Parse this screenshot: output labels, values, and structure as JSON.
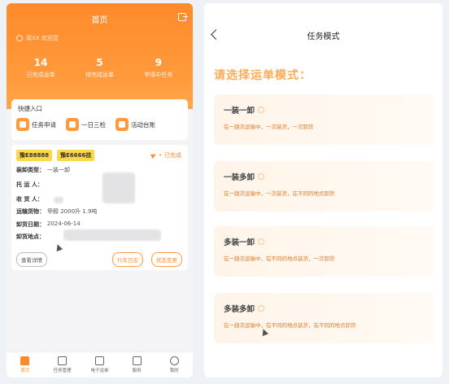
{
  "left": {
    "header": {
      "title": "首页",
      "user": "周XX  欢迎您"
    },
    "stats": [
      {
        "num": "14",
        "label": "已完成运单"
      },
      {
        "num": "5",
        "label": "待完成运单"
      },
      {
        "num": "9",
        "label": "申请中任务"
      }
    ],
    "quick": {
      "title": "快捷入口",
      "items": [
        "任务申请",
        "一日三检",
        "活动台账"
      ]
    },
    "order": {
      "plates": [
        "豫E88888",
        "豫E6666挂"
      ],
      "status": "已完成",
      "rows": [
        {
          "label": "装卸类型：",
          "value": "一装一卸"
        },
        {
          "label": "托 运 人：",
          "value": ""
        },
        {
          "label": "收 货 人：",
          "value": ""
        },
        {
          "label": "运输货物：",
          "value": "甲醇 2000升 1.9吨"
        },
        {
          "label": "卸货日期：",
          "value": "2024-06-14"
        },
        {
          "label": "卸货地点：",
          "value": ""
        }
      ],
      "buttons": {
        "detail": "查看详情",
        "log": "行车日志",
        "status": "状态变更"
      }
    },
    "tabs": [
      "首页",
      "任务管理",
      "电子运单",
      "服务",
      "我的"
    ]
  },
  "right": {
    "nav_title": "任务模式",
    "prompt": "请选择运单模式：",
    "modes": [
      {
        "name": "一装一卸",
        "desc": "在一趟次运输中，一次装货，一次卸货"
      },
      {
        "name": "一装多卸",
        "desc": "在一趟次运输中，一次装货，在不同的地点卸货"
      },
      {
        "name": "多装一卸",
        "desc": "在一趟次运输中，在不同的地点装货，一次卸货"
      },
      {
        "name": "多装多卸",
        "desc": "在一趟次运输中，在不同的地点装货，在不同的地点卸货"
      }
    ]
  },
  "colors": {
    "accent": "#ff8a2a",
    "plate": "#ffd84a"
  }
}
